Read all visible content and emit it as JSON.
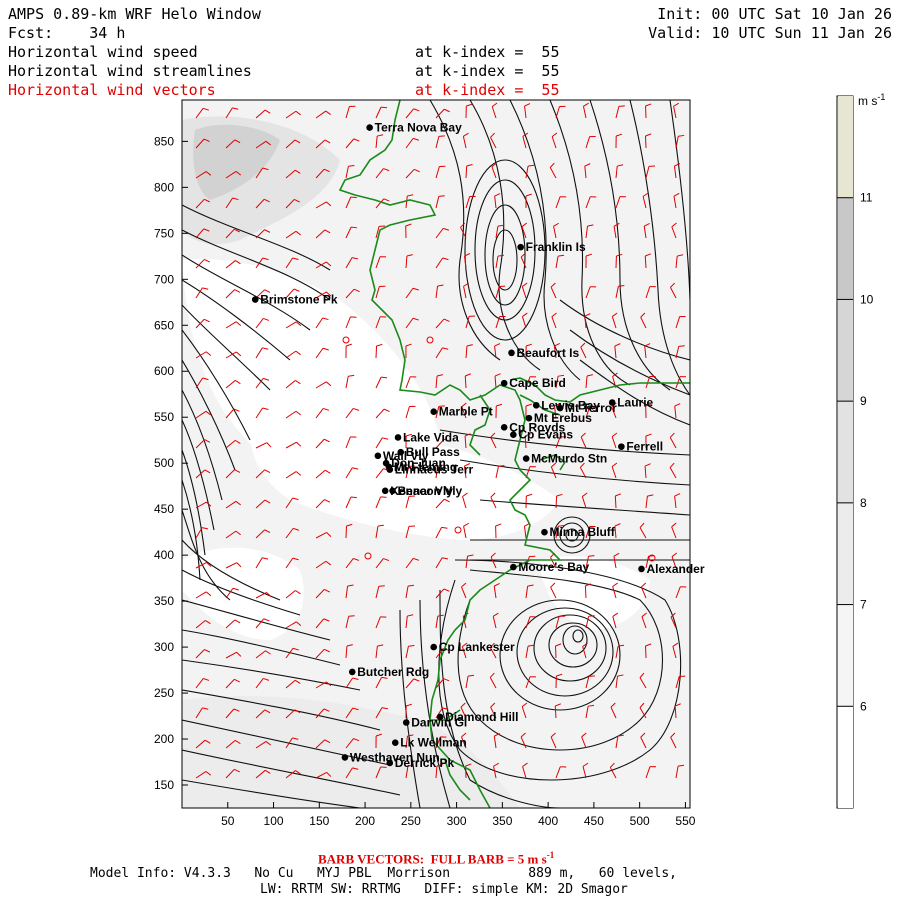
{
  "header": {
    "title": "AMPS 0.89-km WRF Helo Window",
    "init": "Init: 00 UTC Sat 10 Jan 26",
    "fcst_label": "Fcst:",
    "fcst_value": "34 h",
    "valid": "Valid: 10 UTC Sun 11 Jan 26",
    "fields": [
      {
        "name": "Horizontal wind speed",
        "level": "at k-index =  55"
      },
      {
        "name": "Horizontal wind streamlines",
        "level": "at k-index =  55"
      },
      {
        "name": "Horizontal wind vectors",
        "level": "at k-index =  55"
      }
    ]
  },
  "colorbar": {
    "unit": "m s",
    "unit_exp": "-1",
    "ticks": [
      "11",
      "10",
      "9",
      "8",
      "7",
      "6"
    ],
    "colors": [
      "#e6e6d2",
      "#c8c8c8",
      "#d6d6d6",
      "#e2e2e2",
      "#ececec",
      "#f5f5f5",
      "#ffffff"
    ]
  },
  "axes": {
    "x_ticks": [
      "50",
      "100",
      "150",
      "200",
      "250",
      "300",
      "350",
      "400",
      "450",
      "500",
      "550"
    ],
    "y_ticks": [
      "850",
      "800",
      "750",
      "700",
      "650",
      "600",
      "550",
      "500",
      "450",
      "400",
      "350",
      "300",
      "250",
      "200",
      "150"
    ],
    "x_range": [
      0,
      555
    ],
    "y_range": [
      125,
      895
    ]
  },
  "places": [
    {
      "name": "Terra Nova Bay",
      "x": 205,
      "y": 865
    },
    {
      "name": "Franklin Is",
      "x": 370,
      "y": 735
    },
    {
      "name": "Brimstone Pk",
      "x": 80,
      "y": 678
    },
    {
      "name": "Beaufort Is",
      "x": 360,
      "y": 620
    },
    {
      "name": "Cape Bird",
      "x": 352,
      "y": 587
    },
    {
      "name": "Lewis Bay",
      "x": 387,
      "y": 563
    },
    {
      "name": "Laurie",
      "x": 470,
      "y": 566
    },
    {
      "name": "Mt Terror",
      "x": 413,
      "y": 560
    },
    {
      "name": "Marble Pt",
      "x": 275,
      "y": 556
    },
    {
      "name": "Mt Erebus",
      "x": 379,
      "y": 549
    },
    {
      "name": "Cp Royds",
      "x": 352,
      "y": 539
    },
    {
      "name": "Lake Vida",
      "x": 236,
      "y": 528
    },
    {
      "name": "Cp Evans",
      "x": 362,
      "y": 531
    },
    {
      "name": "Ferrell",
      "x": 480,
      "y": 518
    },
    {
      "name": "Wall Vly",
      "x": 214,
      "y": 508
    },
    {
      "name": "Bull Pass",
      "x": 239,
      "y": 512
    },
    {
      "name": "McMurdo Stn",
      "x": 376,
      "y": 505
    },
    {
      "name": "Don Juan",
      "x": 223,
      "y": 500
    },
    {
      "name": "Mt Fleming",
      "x": 226,
      "y": 496
    },
    {
      "name": "Linnaeus Terr",
      "x": 227,
      "y": 493
    },
    {
      "name": "Kennar Vly",
      "x": 222,
      "y": 470
    },
    {
      "name": "Beacon Vly",
      "x": 230,
      "y": 470
    },
    {
      "name": "Minna Bluff",
      "x": 396,
      "y": 425
    },
    {
      "name": "Moore's Bay",
      "x": 362,
      "y": 387
    },
    {
      "name": "Alexander",
      "x": 502,
      "y": 385
    },
    {
      "name": "Cp Lankester",
      "x": 275,
      "y": 300
    },
    {
      "name": "Butcher Rdg",
      "x": 186,
      "y": 273
    },
    {
      "name": "Darwin Gl",
      "x": 245,
      "y": 218
    },
    {
      "name": "Diamond Hill",
      "x": 282,
      "y": 224
    },
    {
      "name": "Lk Wellman",
      "x": 233,
      "y": 196
    },
    {
      "name": "Westhaven Nun",
      "x": 178,
      "y": 180
    },
    {
      "name": "Derrick Pk",
      "x": 227,
      "y": 174
    }
  ],
  "footer": {
    "barb_note": "BARB VECTORS:  FULL BARB = 5 m s",
    "barb_exp": "-1",
    "model_info": "Model Info: V4.3.3   No Cu   MYJ PBL  Morrison          889 m,   60 levels,",
    "physics": "LW: RRTM SW: RRTMG   DIFF: simple KM: 2D Smagor"
  }
}
